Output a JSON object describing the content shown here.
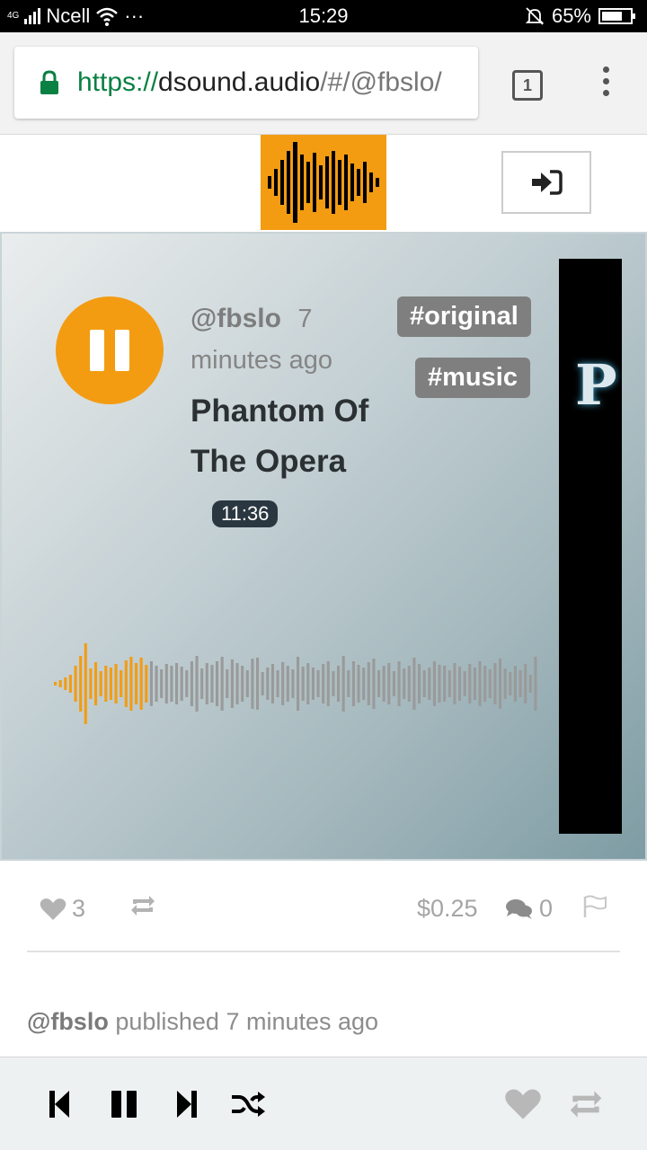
{
  "status_bar": {
    "network": "4G",
    "carrier": "Ncell",
    "more": "···",
    "time": "15:29",
    "battery": "65%"
  },
  "browser": {
    "url_scheme": "https://",
    "url_host": "dsound.audio",
    "url_path": "/#/@fbslo/",
    "tab_count": "1"
  },
  "track": {
    "author": "@fbslo",
    "time_ago": "7 minutes ago",
    "title": "Phantom Of The Opera",
    "duration": "11:36",
    "tags": [
      "#original",
      "#music"
    ],
    "cover_letter": "P",
    "progress": 0.2
  },
  "actions": {
    "likes": "3",
    "payout": "$0.25",
    "comments": "0"
  },
  "published": {
    "author": "@fbslo",
    "text": "published 7 minutes ago"
  },
  "colors": {
    "accent": "#f39c12",
    "played_wave": "#f39c12",
    "unplayed_wave": "#9a9a9a",
    "tag_bg": "#7f7f7f",
    "duration_bg": "#2a3740"
  }
}
